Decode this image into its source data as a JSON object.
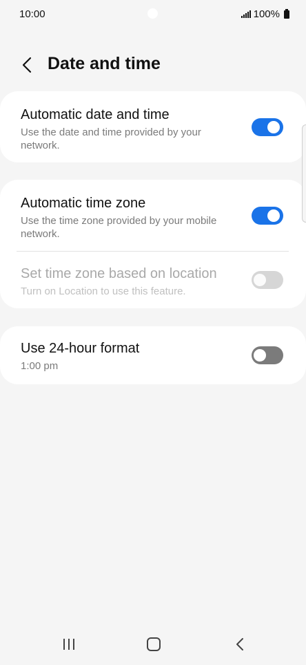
{
  "status_bar": {
    "time": "10:00",
    "battery": "100%"
  },
  "header": {
    "title": "Date and time"
  },
  "settings": {
    "automatic_date_time": {
      "title": "Automatic date and time",
      "description": "Use the date and time provided by your network.",
      "state": "on"
    },
    "automatic_time_zone": {
      "title": "Automatic time zone",
      "description": "Use the time zone provided by your mobile network.",
      "state": "on"
    },
    "location_time_zone": {
      "title": "Set time zone based on location",
      "description": "Turn on Location to use this feature.",
      "state": "disabled"
    },
    "use_24_hour": {
      "title": "Use 24-hour format",
      "description": "1:00 pm",
      "state": "off"
    }
  },
  "colors": {
    "accent": "#1a73e8",
    "background": "#f5f5f5",
    "card": "#ffffff"
  }
}
